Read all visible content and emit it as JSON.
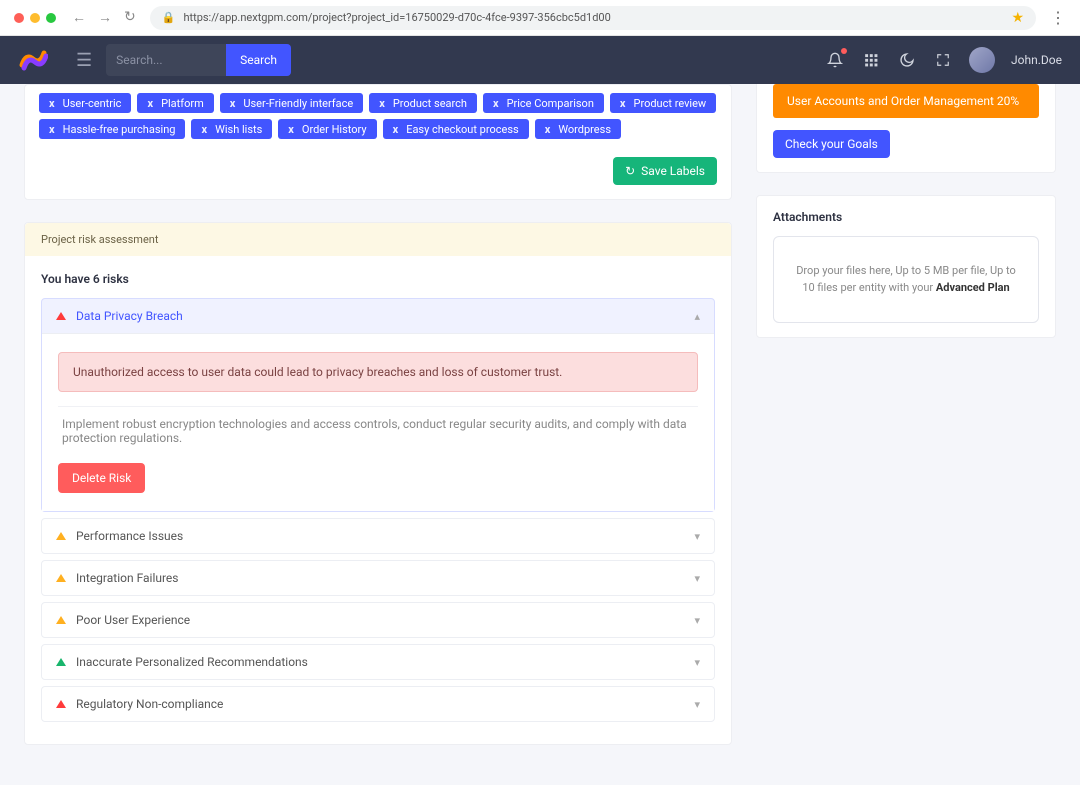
{
  "browser": {
    "url": "https://app.nextgpm.com/project?project_id=16750029-d70c-4fce-9397-356cbc5d1d00"
  },
  "topbar": {
    "search_placeholder": "Search...",
    "search_button": "Search",
    "user": "John.Doe"
  },
  "labels": {
    "items": [
      "User-centric",
      "Platform",
      "User-Friendly interface",
      "Product search",
      "Price Comparison",
      "Product review",
      "Hassle-free purchasing",
      "Wish lists",
      "Order History",
      "Easy checkout process",
      "Wordpress"
    ],
    "save_button": "Save Labels"
  },
  "goal_bar": {
    "text": "User Accounts and Order Management 20%",
    "check_button": "Check your Goals"
  },
  "risk": {
    "banner": "Project risk assessment",
    "count_text": "You have 6 risks",
    "open": {
      "title": "Data Privacy Breach",
      "severity": "red",
      "alert": "Unauthorized access to user data could lead to privacy breaches and loss of customer trust.",
      "mitigation": "Implement robust encryption technologies and access controls, conduct regular security audits, and comply with data protection regulations.",
      "delete": "Delete Risk"
    },
    "closed": [
      {
        "title": "Performance Issues",
        "severity": "yellow"
      },
      {
        "title": "Integration Failures",
        "severity": "yellow"
      },
      {
        "title": "Poor User Experience",
        "severity": "yellow"
      },
      {
        "title": "Inaccurate Personalized Recommendations",
        "severity": "green"
      },
      {
        "title": "Regulatory Non-compliance",
        "severity": "red"
      }
    ]
  },
  "attachments": {
    "title": "Attachments",
    "drop_prefix": "Drop your files here, Up to 5 MB per file, Up to 10 files per entity with your ",
    "drop_bold": "Advanced Plan"
  }
}
